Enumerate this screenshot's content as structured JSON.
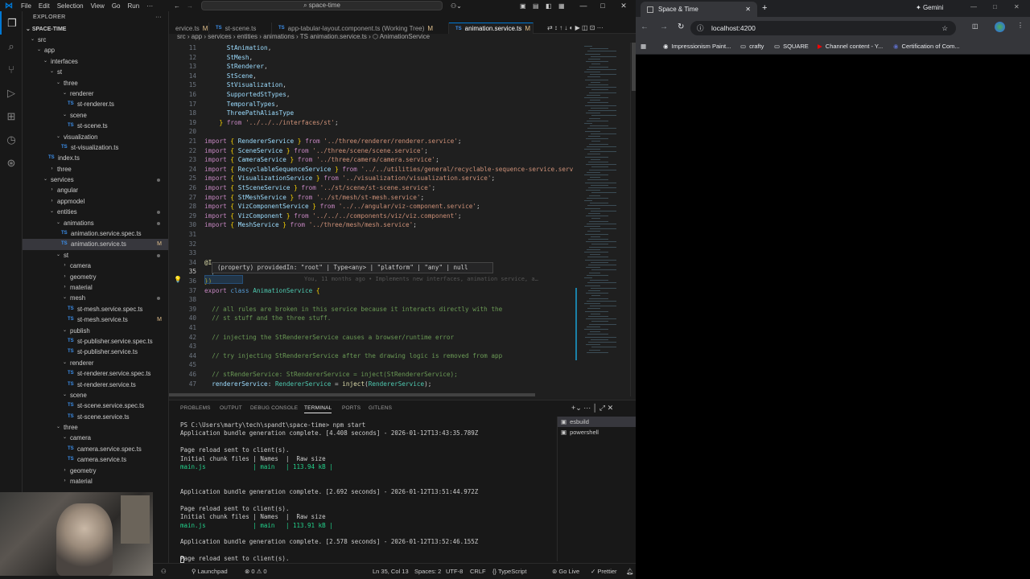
{
  "vscode": {
    "menu": [
      "File",
      "Edit",
      "Selection",
      "View",
      "Go",
      "Run"
    ],
    "command_center": "space-time",
    "activity_icons": [
      "explorer-icon",
      "search-icon",
      "source-control-icon",
      "run-debug-icon",
      "extensions-icon",
      "remote-explorer-icon",
      "gitlens-icon"
    ],
    "sidebar": {
      "header": "EXPLORER",
      "root": "SPACE-TIME",
      "items": [
        {
          "label": "src",
          "depth": 0,
          "kind": "folder-open"
        },
        {
          "label": "app",
          "depth": 1,
          "kind": "folder-open"
        },
        {
          "label": "interfaces",
          "depth": 2,
          "kind": "folder-open"
        },
        {
          "label": "st",
          "depth": 3,
          "kind": "folder-open"
        },
        {
          "label": "three",
          "depth": 4,
          "kind": "folder-open"
        },
        {
          "label": "renderer",
          "depth": 5,
          "kind": "folder-open"
        },
        {
          "label": "st-renderer.ts",
          "depth": 6,
          "kind": "ts"
        },
        {
          "label": "scene",
          "depth": 5,
          "kind": "folder-open"
        },
        {
          "label": "st-scene.ts",
          "depth": 6,
          "kind": "ts"
        },
        {
          "label": "visualization",
          "depth": 4,
          "kind": "folder-open"
        },
        {
          "label": "st-visualization.ts",
          "depth": 5,
          "kind": "ts"
        },
        {
          "label": "index.ts",
          "depth": 3,
          "kind": "ts"
        },
        {
          "label": "three",
          "depth": 3,
          "kind": "folder"
        },
        {
          "label": "services",
          "depth": 2,
          "kind": "folder-open",
          "dot": true
        },
        {
          "label": "angular",
          "depth": 3,
          "kind": "folder"
        },
        {
          "label": "appmodel",
          "depth": 3,
          "kind": "folder"
        },
        {
          "label": "entities",
          "depth": 3,
          "kind": "folder-open",
          "dot": true
        },
        {
          "label": "animations",
          "depth": 4,
          "kind": "folder-open",
          "dot": true
        },
        {
          "label": "animation.service.spec.ts",
          "depth": 5,
          "kind": "ts"
        },
        {
          "label": "animation.service.ts",
          "depth": 5,
          "kind": "ts",
          "badge": "M",
          "selected": true
        },
        {
          "label": "st",
          "depth": 4,
          "kind": "folder-open",
          "dot": true
        },
        {
          "label": "camera",
          "depth": 5,
          "kind": "folder"
        },
        {
          "label": "geometry",
          "depth": 5,
          "kind": "folder"
        },
        {
          "label": "material",
          "depth": 5,
          "kind": "folder"
        },
        {
          "label": "mesh",
          "depth": 5,
          "kind": "folder-open",
          "dot": true
        },
        {
          "label": "st-mesh.service.spec.ts",
          "depth": 6,
          "kind": "ts"
        },
        {
          "label": "st-mesh.service.ts",
          "depth": 6,
          "kind": "ts",
          "badge": "M"
        },
        {
          "label": "publish",
          "depth": 5,
          "kind": "folder-open"
        },
        {
          "label": "st-publisher.service.spec.ts",
          "depth": 6,
          "kind": "ts"
        },
        {
          "label": "st-publisher.service.ts",
          "depth": 6,
          "kind": "ts"
        },
        {
          "label": "renderer",
          "depth": 5,
          "kind": "folder-open"
        },
        {
          "label": "st-renderer.service.spec.ts",
          "depth": 6,
          "kind": "ts"
        },
        {
          "label": "st-renderer.service.ts",
          "depth": 6,
          "kind": "ts"
        },
        {
          "label": "scene",
          "depth": 5,
          "kind": "folder-open"
        },
        {
          "label": "st-scene.service.spec.ts",
          "depth": 6,
          "kind": "ts"
        },
        {
          "label": "st-scene.service.ts",
          "depth": 6,
          "kind": "ts"
        },
        {
          "label": "three",
          "depth": 4,
          "kind": "folder-open"
        },
        {
          "label": "camera",
          "depth": 5,
          "kind": "folder-open"
        },
        {
          "label": "camera.service.spec.ts",
          "depth": 6,
          "kind": "ts"
        },
        {
          "label": "camera.service.ts",
          "depth": 6,
          "kind": "ts"
        },
        {
          "label": "geometry",
          "depth": 5,
          "kind": "folder"
        },
        {
          "label": "material",
          "depth": 5,
          "kind": "folder"
        }
      ]
    },
    "tabs": [
      {
        "label": "ervice.ts",
        "modified": "M"
      },
      {
        "label": "st-scene.ts",
        "modified": ""
      },
      {
        "label": "app-tabular-layout.component.ts (Working Tree)",
        "modified": "M"
      },
      {
        "label": "animation.service.ts",
        "modified": "M",
        "active": true
      }
    ],
    "breadcrumb": "src › app › services › entities › animations › TS animation.service.ts › ⬡ AnimationService",
    "hover_text": "(property) providedIn: \"root\" | Type<any> | \"platform\" | \"any\" | null",
    "blame_text": "You, 11 months ago • Implements new interfaces, animation service, a…",
    "code_lines": [
      {
        "n": "11",
        "html": "<span class=\"id\">      StAnimation</span>,"
      },
      {
        "n": "12",
        "html": "<span class=\"id\">      StMesh</span>,"
      },
      {
        "n": "13",
        "html": "<span class=\"id\">      StRenderer</span>,"
      },
      {
        "n": "14",
        "html": "<span class=\"id\">      StScene</span>,"
      },
      {
        "n": "15",
        "html": "<span class=\"id\">      StVisualization</span>,"
      },
      {
        "n": "16",
        "html": "<span class=\"id\">      SupportedStTypes</span>,"
      },
      {
        "n": "17",
        "html": "<span class=\"id\">      TemporalTypes</span>,"
      },
      {
        "n": "18",
        "html": "<span class=\"id\">      ThreePathAliasType</span>"
      },
      {
        "n": "19",
        "html": "    <span class=\"pun\">}</span> <span class=\"kw\">from</span> <span class=\"str\">'../../../interfaces/st'</span>;"
      },
      {
        "n": "20",
        "html": ""
      },
      {
        "n": "21",
        "html": "<span class=\"kw\">import</span> <span class=\"pun\">{</span> <span class=\"id\">RendererService</span> <span class=\"pun\">}</span> <span class=\"kw\">from</span> <span class=\"str\">'../three/renderer/renderer.service'</span>;"
      },
      {
        "n": "22",
        "html": "<span class=\"kw\">import</span> <span class=\"pun\">{</span> <span class=\"id\">SceneService</span> <span class=\"pun\">}</span> <span class=\"kw\">from</span> <span class=\"str\">'../three/scene/scene.service'</span>;"
      },
      {
        "n": "23",
        "html": "<span class=\"kw\">import</span> <span class=\"pun\">{</span> <span class=\"id\">CameraService</span> <span class=\"pun\">}</span> <span class=\"kw\">from</span> <span class=\"str\">'../three/camera/camera.service'</span>;"
      },
      {
        "n": "24",
        "html": "<span class=\"kw\">import</span> <span class=\"pun\">{</span> <span class=\"id\">RecyclableSequenceService</span> <span class=\"pun\">}</span> <span class=\"kw\">from</span> <span class=\"str\">'../../utilities/general/recyclable-sequence-service.serv</span>"
      },
      {
        "n": "25",
        "html": "<span class=\"kw\">import</span> <span class=\"pun\">{</span> <span class=\"id\">VisualizationService</span> <span class=\"pun\">}</span> <span class=\"kw\">from</span> <span class=\"str\">'../visualization/visualization.service'</span>;"
      },
      {
        "n": "26",
        "html": "<span class=\"kw\">import</span> <span class=\"pun\">{</span> <span class=\"id\">StSceneService</span> <span class=\"pun\">}</span> <span class=\"kw\">from</span> <span class=\"str\">'../st/scene/st-scene.service'</span>;"
      },
      {
        "n": "27",
        "html": "<span class=\"kw\">import</span> <span class=\"pun\">{</span> <span class=\"id\">StMeshService</span> <span class=\"pun\">}</span> <span class=\"kw\">from</span> <span class=\"str\">'../st/mesh/st-mesh.service'</span>;"
      },
      {
        "n": "28",
        "html": "<span class=\"kw\">import</span> <span class=\"pun\">{</span> <span class=\"id\">VizComponentService</span> <span class=\"pun\">}</span> <span class=\"kw\">from</span> <span class=\"str\">'../../angular/viz-component.service'</span>;"
      },
      {
        "n": "29",
        "html": "<span class=\"kw\">import</span> <span class=\"pun\">{</span> <span class=\"id\">VizComponent</span> <span class=\"pun\">}</span> <span class=\"kw\">from</span> <span class=\"str\">'../../../components/viz/viz.component'</span>;"
      },
      {
        "n": "30",
        "html": "<span class=\"kw\">import</span> <span class=\"pun\">{</span> <span class=\"id\">MeshService</span> <span class=\"pun\">}</span> <span class=\"kw\">from</span> <span class=\"str\">'../three/mesh/mesh.service'</span>;"
      },
      {
        "n": "31",
        "html": ""
      },
      {
        "n": "32",
        "html": ""
      },
      {
        "n": "33",
        "html": ""
      },
      {
        "n": "34",
        "html": "<span class=\"fn\">@I</span>"
      },
      {
        "n": "35",
        "html": "  <span class=\"id\">providedIn</span>: <span class=\"str\">'root'</span>"
      },
      {
        "n": "36",
        "html": "<span class=\"pun\">})</span>"
      },
      {
        "n": "37",
        "html": "<span class=\"kw\">export</span> <span class=\"kw2\">class</span> <span class=\"cls\">AnimationService</span> <span class=\"pun\">{</span>"
      },
      {
        "n": "38",
        "html": ""
      },
      {
        "n": "39",
        "html": "  <span class=\"cm\">// all rules are broken in this service because it interacts directly with the</span>"
      },
      {
        "n": "40",
        "html": "  <span class=\"cm\">// st stuff and the three stuff.</span>"
      },
      {
        "n": "41",
        "html": ""
      },
      {
        "n": "42",
        "html": "  <span class=\"cm\">// injecting the StRendererService causes a browser/runtime error</span>"
      },
      {
        "n": "43",
        "html": ""
      },
      {
        "n": "44",
        "html": "  <span class=\"cm\">// try injecting StRendererService after the drawing logic is removed from app</span>"
      },
      {
        "n": "45",
        "html": ""
      },
      {
        "n": "46",
        "html": "  <span class=\"cm\">// stRenderService: StRendererService = inject(StRendererService);</span>"
      },
      {
        "n": "47",
        "html": "  <span class=\"id\">rendererService</span>: <span class=\"cls\">RendererService</span> = <span class=\"fn\">inject</span>(<span class=\"cls\">RendererService</span>);"
      }
    ],
    "panel_tabs": [
      "PROBLEMS",
      "OUTPUT",
      "DEBUG CONSOLE",
      "TERMINAL",
      "PORTS",
      "GITLENS"
    ],
    "panel_active": "TERMINAL",
    "terminal_lines": [
      {
        "t": "PS C:\\Users\\marty\\tech\\spandt\\space-time> npm start",
        "c": ""
      },
      {
        "t": "Application bundle generation complete. [4.408 seconds] - 2026-01-12T13:43:35.789Z",
        "c": ""
      },
      {
        "t": "",
        "c": ""
      },
      {
        "t": "Page reload sent to client(s).",
        "c": ""
      },
      {
        "t": "Initial chunk files | Names  |  Raw size",
        "c": ""
      },
      {
        "t": "main.js             | main   | 113.94 kB |",
        "c": "grn"
      },
      {
        "t": "",
        "c": ""
      },
      {
        "t": "",
        "c": ""
      },
      {
        "t": "Application bundle generation complete. [2.692 seconds] - 2026-01-12T13:51:44.972Z",
        "c": ""
      },
      {
        "t": "",
        "c": ""
      },
      {
        "t": "Page reload sent to client(s).",
        "c": ""
      },
      {
        "t": "Initial chunk files | Names  |  Raw size",
        "c": ""
      },
      {
        "t": "main.js             | main   | 113.91 kB |",
        "c": "grn"
      },
      {
        "t": "",
        "c": ""
      },
      {
        "t": "Application bundle generation complete. [2.578 seconds] - 2026-01-12T13:52:46.155Z",
        "c": ""
      },
      {
        "t": "",
        "c": ""
      },
      {
        "t": "Page reload sent to client(s).",
        "c": ""
      }
    ],
    "terminals": [
      "esbuild",
      "powershell"
    ],
    "status": {
      "launchpad": "Launchpad",
      "problems": "⊗ 0 ⚠ 0",
      "position": "Ln 35, Col 13",
      "spaces": "Spaces: 2",
      "encoding": "UTF-8",
      "eol": "CRLF",
      "language": "TypeScript",
      "golive": "Go Live",
      "prettier": "Prettier"
    }
  },
  "browser": {
    "tab_title": "Space & Time",
    "gemini": "Gemini",
    "url": "localhost:4200",
    "bookmarks": [
      "Impressionism Paint...",
      "crafty",
      "SQUARE",
      "Channel content - Y...",
      "Certification of Com..."
    ]
  }
}
